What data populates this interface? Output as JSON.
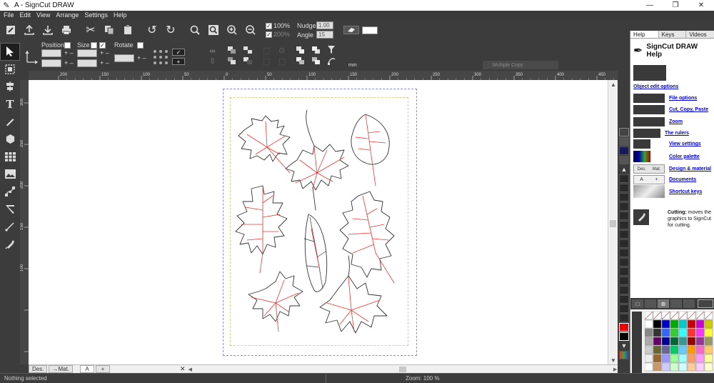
{
  "window": {
    "title": "A - SignCut DRAW",
    "controls": [
      "—",
      "❐",
      "✕"
    ]
  },
  "menu": [
    "File",
    "Edit",
    "View",
    "Arrange",
    "Settings",
    "Help"
  ],
  "toolbar": {
    "zoom_100_label": "100%",
    "zoom_200_label": "200%",
    "nudge_label": "Nudge",
    "nudge_value": "1.00",
    "angle_label": "Angle",
    "angle_value": "15"
  },
  "props": {
    "position_label": "Position",
    "size_label": "Size",
    "rotate_label": "Rotate",
    "units": "mm",
    "tooltip": "Multiple Copy"
  },
  "ruler": {
    "top_ticks": [
      "200",
      "150",
      "100",
      "50",
      "0",
      "50",
      "100",
      "150",
      "200",
      "250",
      "300",
      "350",
      "400",
      "450"
    ],
    "left_ticks": [
      "300",
      "250",
      "200",
      "150",
      "100"
    ]
  },
  "help": {
    "tabs": [
      "Help",
      "Keys",
      "Videos"
    ],
    "title": "SignCut DRAW Help",
    "object_edit": "Object edit options",
    "links": [
      "File options",
      "Cut, Copy, Paste",
      "Zoom",
      "The rulers",
      "View settings",
      "Color palette",
      "Design & material",
      "Documents",
      "Shortcut keys"
    ],
    "note_bold": "Cutting:",
    "note_text": "moves the graphics to SignCut for cutting.",
    "design_tab_labels": [
      "Des.",
      "Mat."
    ]
  },
  "tabs": {
    "design": "Des.",
    "material": "Mat.",
    "doc": "A",
    "add": "+"
  },
  "status": {
    "left": "Nothing selected",
    "zoom": "Zoom: 100 %"
  },
  "colors": {
    "ui_dark": "#3c3c3c",
    "canvas": "#ffffff",
    "page_border": "#8a8ae0",
    "margin_border": "#d6cf88",
    "leaf_outline": "#333333",
    "leaf_vein": "#ee3333",
    "arrow": "#e81c1c",
    "link": "#0000cc"
  }
}
